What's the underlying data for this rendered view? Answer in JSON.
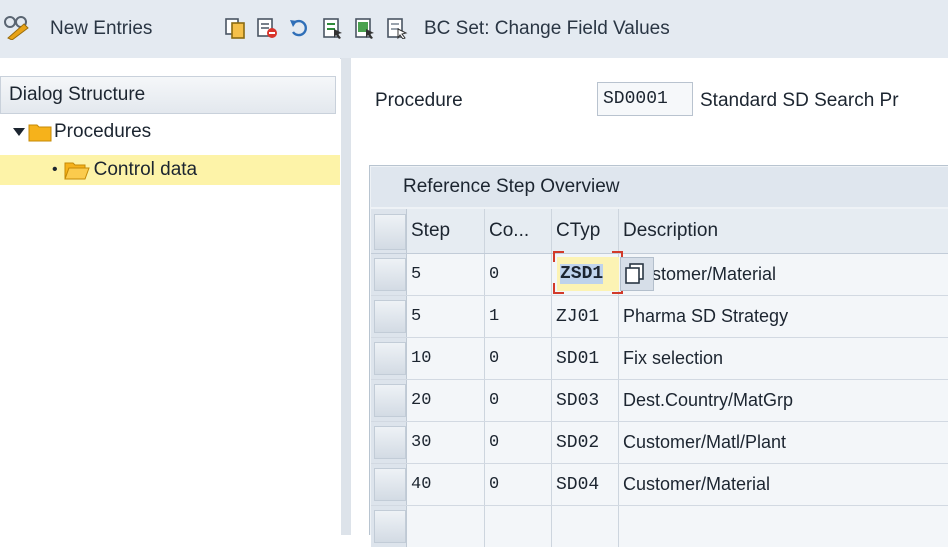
{
  "toolbar": {
    "new_entries_label": "New Entries",
    "bc_set_label": "BC Set: Change Field Values"
  },
  "dialog_structure": {
    "title": "Dialog Structure",
    "items": [
      {
        "label": "Procedures",
        "level": 0,
        "expanded": true
      },
      {
        "label": "Control data",
        "level": 1,
        "selected": true
      }
    ]
  },
  "procedure": {
    "label": "Procedure",
    "value": "SD0001",
    "description": "Standard SD Search Pr"
  },
  "table": {
    "title": "Reference Step Overview",
    "columns": [
      "Step",
      "Co...",
      "CTyp",
      "Description"
    ],
    "rows": [
      {
        "step": "5",
        "co": "0",
        "ctyp": "ZSD1",
        "description": "stomer/Material"
      },
      {
        "step": "5",
        "co": "1",
        "ctyp": "ZJ01",
        "description": "Pharma SD Strategy"
      },
      {
        "step": "10",
        "co": "0",
        "ctyp": "SD01",
        "description": "Fix selection"
      },
      {
        "step": "20",
        "co": "0",
        "ctyp": "SD03",
        "description": "Dest.Country/MatGrp"
      },
      {
        "step": "30",
        "co": "0",
        "ctyp": "SD02",
        "description": "Customer/Matl/Plant"
      },
      {
        "step": "40",
        "co": "0",
        "ctyp": "SD04",
        "description": "Customer/Material"
      },
      {
        "step": "",
        "co": "",
        "ctyp": "",
        "description": ""
      }
    ],
    "focused_cell_value": "ZSD1"
  },
  "colors": {
    "toolbar_bg": "#e4eaf1",
    "selection_yellow": "#fdf3a8",
    "focus_bracket": "#d23a2a",
    "folder_orange": "#f6b21b"
  }
}
